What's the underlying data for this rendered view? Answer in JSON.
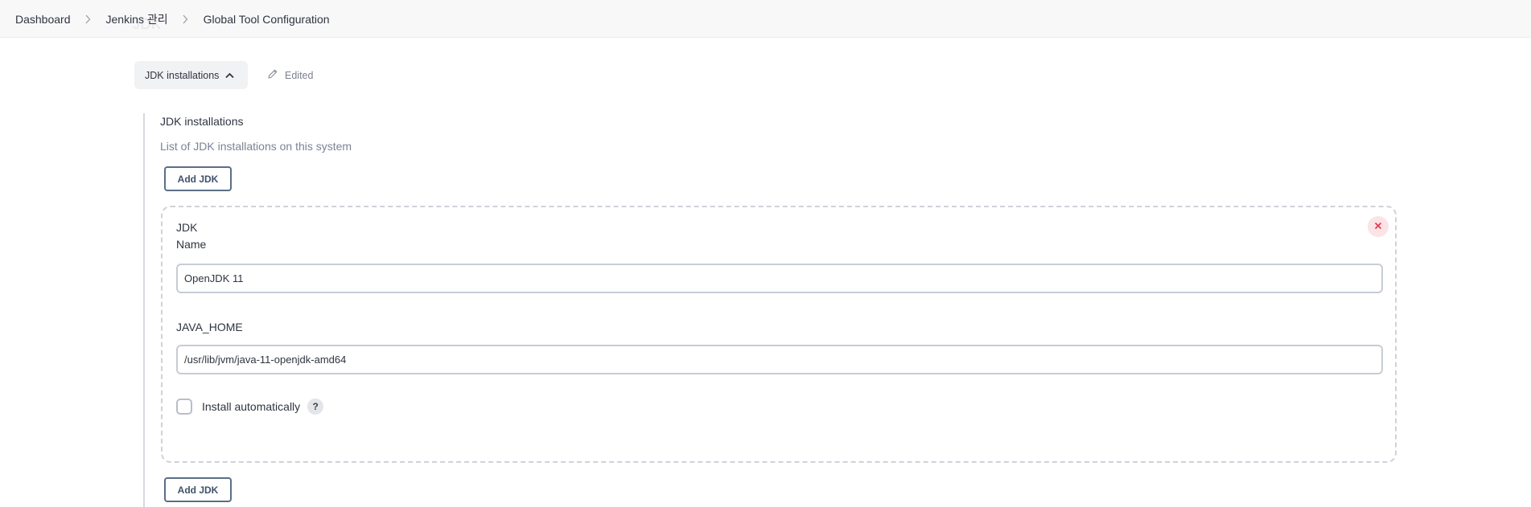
{
  "breadcrumb": {
    "items": [
      "Dashboard",
      "Jenkins 관리",
      "Global Tool Configuration"
    ],
    "ghost_heading": "JDK"
  },
  "section": {
    "toggle_label": "JDK installations",
    "edited_label": "Edited",
    "title": "JDK installations",
    "description": "List of JDK installations on this system",
    "add_button_label": "Add JDK"
  },
  "jdk_card": {
    "title": "JDK",
    "name_label": "Name",
    "name_value": "OpenJDK 11",
    "java_home_label": "JAVA_HOME",
    "java_home_value": "/usr/lib/jvm/java-11-openjdk-amd64",
    "install_automatically_label": "Install automatically",
    "install_automatically_checked": false,
    "help_glyph": "?"
  },
  "icons": {
    "breadcrumb_separator": "chevron-right-icon",
    "toggle": "chevron-up-icon",
    "edited": "pencil-icon",
    "delete": "close-icon"
  },
  "colors": {
    "delete_accent": "#e0384f",
    "button_border": "#5b6e86"
  }
}
